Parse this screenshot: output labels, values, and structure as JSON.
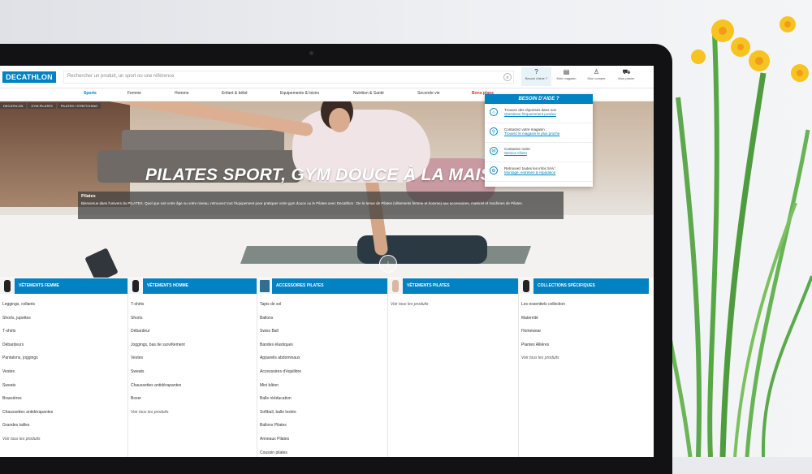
{
  "header": {
    "logo": "DECATHLON",
    "search_placeholder": "Rechercher un produit, un sport ou une référence",
    "icons": [
      {
        "icon": "help-icon",
        "glyph": "?",
        "label": "Besoin d'aide ?"
      },
      {
        "icon": "store-icon",
        "glyph": "▤",
        "label": "Mon magasin"
      },
      {
        "icon": "user-icon",
        "glyph": "♙",
        "label": "Mon compte"
      },
      {
        "icon": "cart-icon",
        "glyph": "⛟",
        "label": "Mon panier"
      }
    ]
  },
  "nav": {
    "items": [
      "Sports",
      "Femme",
      "Homme",
      "Enfant & bébé",
      "Equipements & loisirs",
      "Nutrition & Santé",
      "Seconde vie",
      "Bons plans"
    ]
  },
  "breadcrumb": [
    "DECATHLON",
    "GYM PILATES",
    "PILATES / STRETCHING"
  ],
  "hero": {
    "title": "PILATES SPORT, GYM DOUCE À LA MAISO",
    "desc_title": "Pilates",
    "desc_text": "Bienvenue dans l'univers du PILATES. Quel que soit votre âge ou votre niveau, retrouvez tout l'équipement pour pratiquer votre gym douce ou le Pilates avec Decathlon : De la tenue de Pilates (vêtements femme et homme) aux accessoires, matériel et machines de Pilates."
  },
  "help": {
    "title": "BESOIN D'AIDE ?",
    "rows": [
      {
        "icon": "lightbulb-icon",
        "glyph": "☼",
        "line1": "Trouvez des réponses dans nos",
        "line2": "Questions fréquemment posées"
      },
      {
        "icon": "location-icon",
        "glyph": "⚲",
        "line1": "Contactez votre magasin :",
        "line2": "Trouvez le magasin le plus proche"
      },
      {
        "icon": "chat-icon",
        "glyph": "✉",
        "line1": "Contactez notre",
        "line2": "Service Client"
      },
      {
        "icon": "repair-icon",
        "glyph": "⚙",
        "line1": "Retrouvez toutes les infos SAV :",
        "line2": "Montage, entretien & réparation"
      }
    ]
  },
  "categories": [
    {
      "title": "VÊTEMENTS FEMME",
      "items": [
        "Leggings, collants",
        "Shorts, jupettes",
        "T-shirts",
        "Débardeurs",
        "Pantalons, joggings",
        "Vestes",
        "Sweats",
        "Brassières",
        "Chaussettes antidérapantes",
        "Grandes tailles",
        "Voir tous les produits"
      ]
    },
    {
      "title": "VÊTEMENTS HOMME",
      "items": [
        "T-shirts",
        "Shorts",
        "Débardeur",
        "Joggings, bas de survêtement",
        "Vestes",
        "Sweats",
        "Chaussettes antidérapantes",
        "Boxer",
        "Voir tous les produits"
      ]
    },
    {
      "title": "ACCESSOIRES PILATES",
      "items": [
        "Tapis de sol",
        "Ballons",
        "Swiss Ball",
        "Bandes élastiques",
        "Appareils abdominaux",
        "Accessoires d'équilibre",
        "Mini bâton",
        "Balle rééducation",
        "Softball, balle lestée",
        "Ballons Pilates",
        "Anneaux Pilates",
        "Coussin pilates"
      ]
    },
    {
      "title": "VÊTEMENTS PILATES",
      "items": [
        "Voir tous les produits"
      ]
    },
    {
      "title": "COLLECTIONS SPÉCIFIQUES",
      "items": [
        "Les essentiels collection",
        "Maternité",
        "Homewear",
        "Plantes Allières",
        "Voir tous les produits"
      ]
    }
  ],
  "colors": {
    "brand": "#0082c3",
    "promo": "#e3262f"
  }
}
